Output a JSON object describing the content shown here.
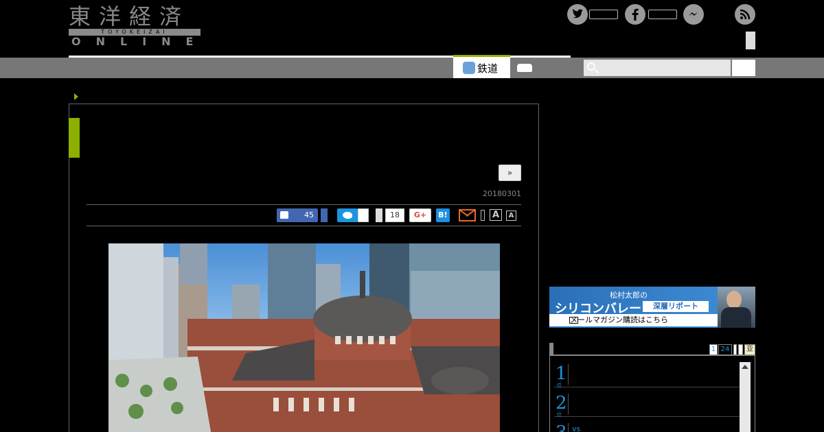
{
  "header": {
    "logo_kanji": "東洋経済",
    "logo_sub": "TOYOKEIZAI",
    "logo_online": "ONLINE"
  },
  "nav": {
    "active_tab": "鉄道",
    "active_color": "#8db000"
  },
  "article": {
    "next_label": "»",
    "date": "20180301"
  },
  "share": {
    "like_count": "45",
    "pocket_count": "18",
    "google_plus": "G+",
    "hatena": "B!",
    "font_big": "A",
    "font_small": "A"
  },
  "sidebar": {
    "banner": {
      "line1": "松村太郎の",
      "title": "シリコンバレー",
      "tag": "深層リポート",
      "cta": "メールマガジン購読はこちら"
    },
    "ranking": {
      "tabs": [
        "1",
        "24",
        "",
        "",
        "亚"
      ],
      "items": [
        {
          "num": "1",
          "text": ""
        },
        {
          "num": "2",
          "text": ""
        },
        {
          "num": "3",
          "text": "vs"
        }
      ]
    }
  },
  "colors": {
    "facebook": "#4267b2",
    "twitter": "#1b95e0",
    "accent": "#8db000",
    "mail": "#e86a2c"
  }
}
